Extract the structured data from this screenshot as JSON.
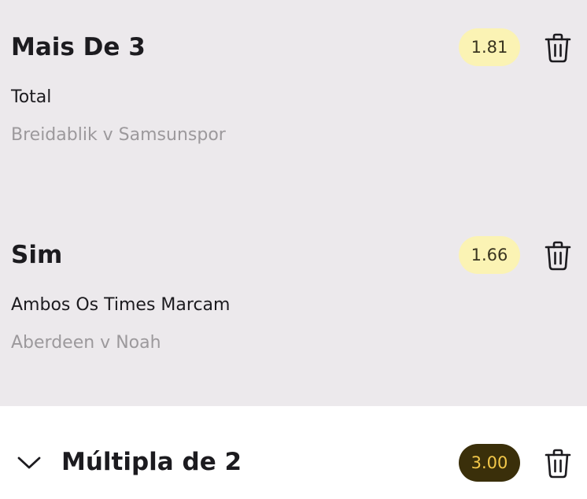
{
  "bets": [
    {
      "selection": "Mais De 3",
      "market": "Total",
      "event": "Breidablik v Samsunspor",
      "odds": "1.81",
      "delete_icon": "trash-icon"
    },
    {
      "selection": "Sim",
      "market": "Ambos Os Times Marcam",
      "event": "Aberdeen v Noah",
      "odds": "1.66",
      "delete_icon": "trash-icon"
    }
  ],
  "multiple": {
    "expand_icon": "chevron-down-icon",
    "title": "Múltipla de 2",
    "odds": "3.00",
    "delete_icon": "trash-icon"
  },
  "colors": {
    "background": "#ece9ec",
    "odds_pill": "#fbf3b4",
    "multi_odds_pill": "#3a2f0a",
    "multi_odds_text": "#f3c84a"
  }
}
